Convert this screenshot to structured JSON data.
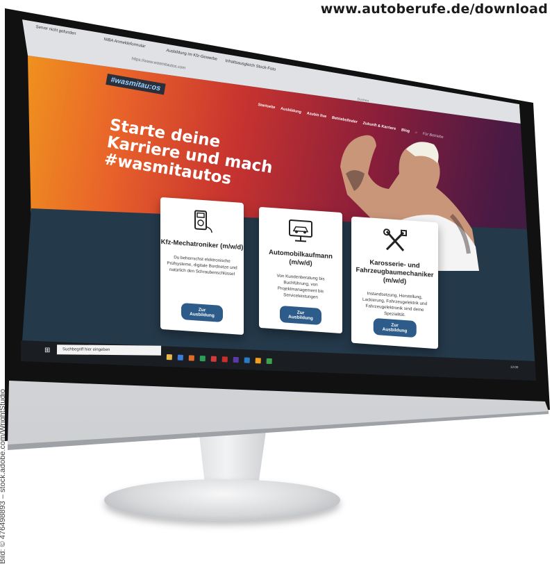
{
  "header_url": "www.autoberufe.de/download",
  "photo_credit": "Bild: © 476498893 – stock.adobe.com/WrightStudio",
  "browser": {
    "tabs": [
      "Server nicht gefunden",
      "NIBA Anmeldeformular",
      "Ausbildung im Kfz-Gewerbe",
      "Inhaltsausgleich Stock-Foto"
    ],
    "url": "https://www.wasmitautos.com",
    "search_placeholder": "Suchen"
  },
  "site": {
    "logo": "#wasmitau:os",
    "nav": [
      "Startseite",
      "Ausbildung",
      "Azubis live",
      "Betriebsfinder",
      "Zukunft & Karriere",
      "Blog"
    ],
    "nav_search": "Für Betriebe",
    "headline": "Starte deine Karriere und mach #wasmitautos",
    "cards": [
      {
        "title": "Kfz-Mechatroniker (m/w/d)",
        "description": "Du beherrschst elektronische Prüfsysteme, digitale Bordnetze und natürlich den Schraubenschlüssel",
        "button": "Zur Ausbildung",
        "icon": "multimeter-icon"
      },
      {
        "title": "Automobilkaufmann (m/w/d)",
        "description": "Von Kundenberatung bis Buchführung, von Projektmanagement bis Serviceleistungen",
        "button": "Zur Ausbildung",
        "icon": "car-monitor-icon"
      },
      {
        "title": "Karosserie- und Fahrzeugbaumechaniker (m/w/d)",
        "description": "Instandsetzung, Herstellung, Lackierung, Fahrzeugelektrik und Fahrzeugelektronik sind deine Spezialität.",
        "button": "Zur Ausbildung",
        "icon": "tools-icon"
      }
    ]
  },
  "taskbar": {
    "search_placeholder": "Suchbegriff hier eingeben",
    "clock": "12:00"
  },
  "colors": {
    "hero_start": "#f2a21b",
    "hero_end": "#2e1f3f",
    "lower_band": "#24394a",
    "button": "#2d5c8a"
  }
}
